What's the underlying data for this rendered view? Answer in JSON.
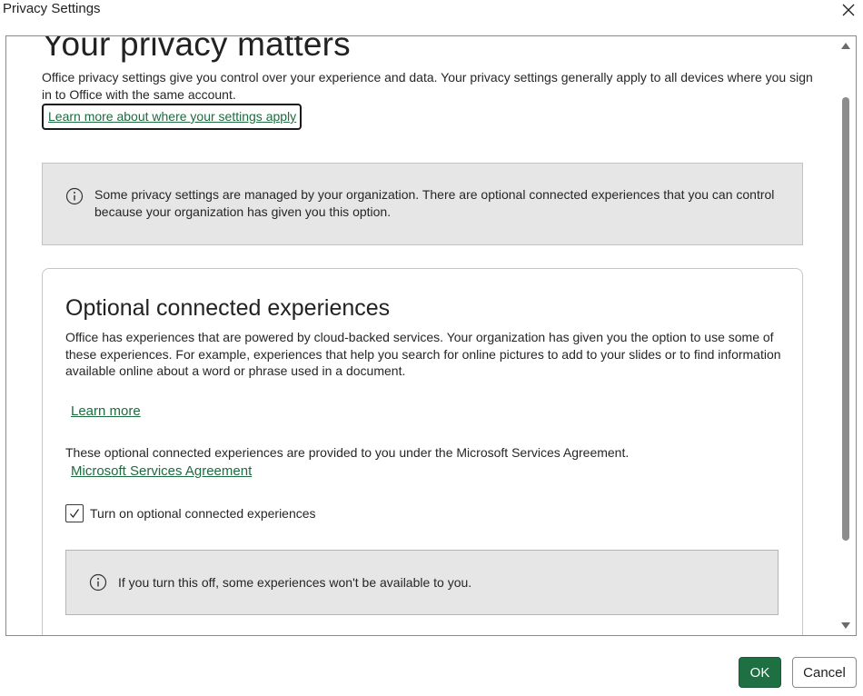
{
  "window": {
    "title": "Privacy Settings",
    "close_icon": "close-icon"
  },
  "page": {
    "heading": "Your privacy matters",
    "intro": "Office privacy settings give you control over your experience and data. Your privacy settings generally apply to all devices where you sign in to Office with the same account.",
    "learn_where_link": "Learn more about where your settings apply"
  },
  "managed_notice": {
    "icon": "info-icon",
    "text": "Some privacy settings are managed by your organization. There are optional connected experiences that you can control because your organization has given you this option."
  },
  "optional_card": {
    "title": "Optional connected experiences",
    "description": "Office has experiences that are powered by cloud-backed services. Your organization has given you the option to use some of these experiences. For example, experiences that help you search for online pictures to add to your slides or to find information available online about a word or phrase used in a document.",
    "learn_more_link": "Learn more",
    "msa_text": "These optional connected experiences are provided to you under the Microsoft Services Agreement.",
    "msa_link": "Microsoft Services Agreement",
    "checkbox_label": "Turn on optional connected experiences",
    "checkbox_checked": true,
    "warning_icon": "info-icon",
    "warning_text": "If you turn this off, some experiences won't be available to you."
  },
  "buttons": {
    "ok": "OK",
    "cancel": "Cancel"
  },
  "colors": {
    "accent": "#1e6f42",
    "link": "#1d6b3f",
    "notice_bg": "#e6e6e6"
  }
}
